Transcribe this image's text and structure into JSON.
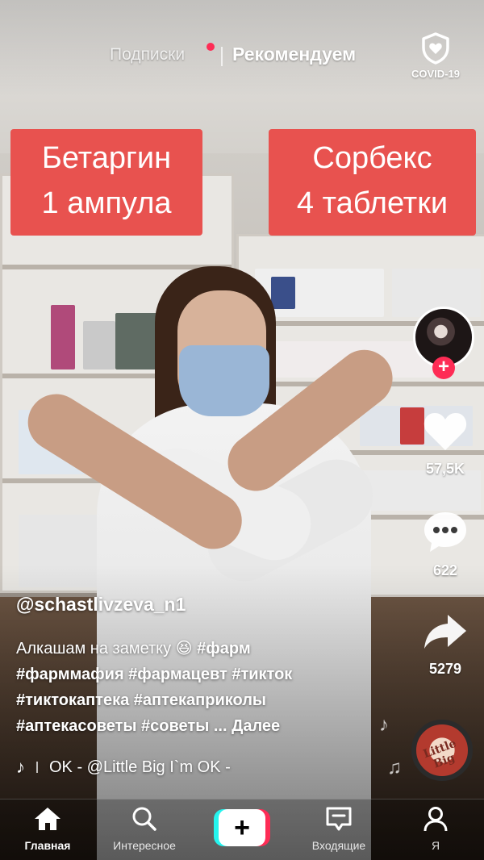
{
  "top_nav": {
    "following_label": "Подписки",
    "for_you_label": "Рекомендуем",
    "covid_label": "COVID-19"
  },
  "overlay": {
    "left": {
      "line1": "Бетаргин",
      "line2": "1 ампула"
    },
    "right": {
      "line1": "Сорбекс",
      "line2": "4 таблетки"
    }
  },
  "actions": {
    "likes": "57,5K",
    "comments": "622",
    "shares": "5279"
  },
  "post": {
    "username": "@schastlivzeva_n1",
    "caption_text": "Алкашам на заметку",
    "caption_emoji": "😆",
    "hashtags_line1": "#фарм",
    "hashtags_line2": "#фарммафия #фармацевт #тикток",
    "hashtags_line3": "#тиктокаптека #аптекаприколы",
    "hashtags_line4": "#аптекасоветы #советы",
    "more_label": "... Далее"
  },
  "music": {
    "track": "OK - @Little Big   I`m OK -",
    "disc_label": "Little Big"
  },
  "bottom_nav": {
    "home": "Главная",
    "discover": "Интересное",
    "inbox": "Входящие",
    "me": "Я"
  },
  "colors": {
    "accent": "#fe2c55",
    "label_red": "#e8524f",
    "tiktok_cyan": "#25f4ee"
  }
}
